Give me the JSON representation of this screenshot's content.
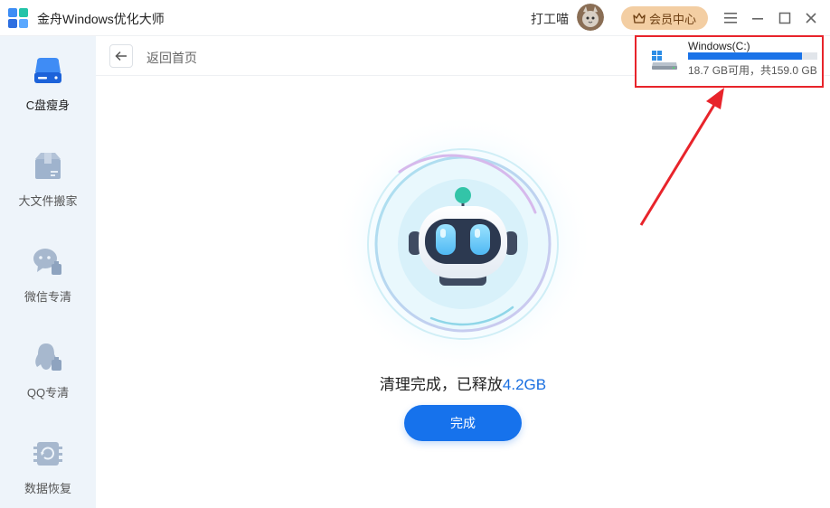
{
  "window": {
    "title": "金舟Windows优化大师",
    "username": "打工喵",
    "vip_label": "会员中心"
  },
  "sidebar": {
    "items": [
      {
        "label": "C盘瘦身",
        "icon": "drive-icon",
        "active": true
      },
      {
        "label": "大文件搬家",
        "icon": "box-icon",
        "active": false
      },
      {
        "label": "微信专清",
        "icon": "wechat-icon",
        "active": false
      },
      {
        "label": "QQ专清",
        "icon": "qq-icon",
        "active": false
      },
      {
        "label": "数据恢复",
        "icon": "recovery-icon",
        "active": false
      }
    ]
  },
  "header": {
    "back_label": "返回首页"
  },
  "drive": {
    "name": "Windows(C:)",
    "space_text": "18.7 GB可用，共159.0 GB",
    "used_fraction": 0.882
  },
  "result": {
    "message": "清理完成，已释放",
    "amount": "4.2GB",
    "done_label": "完成"
  },
  "colors": {
    "accent": "#1672ec",
    "highlight_red": "#e8242b",
    "vip_gold": "#f3cea3",
    "sidebar_bg": "#eef4fa"
  }
}
